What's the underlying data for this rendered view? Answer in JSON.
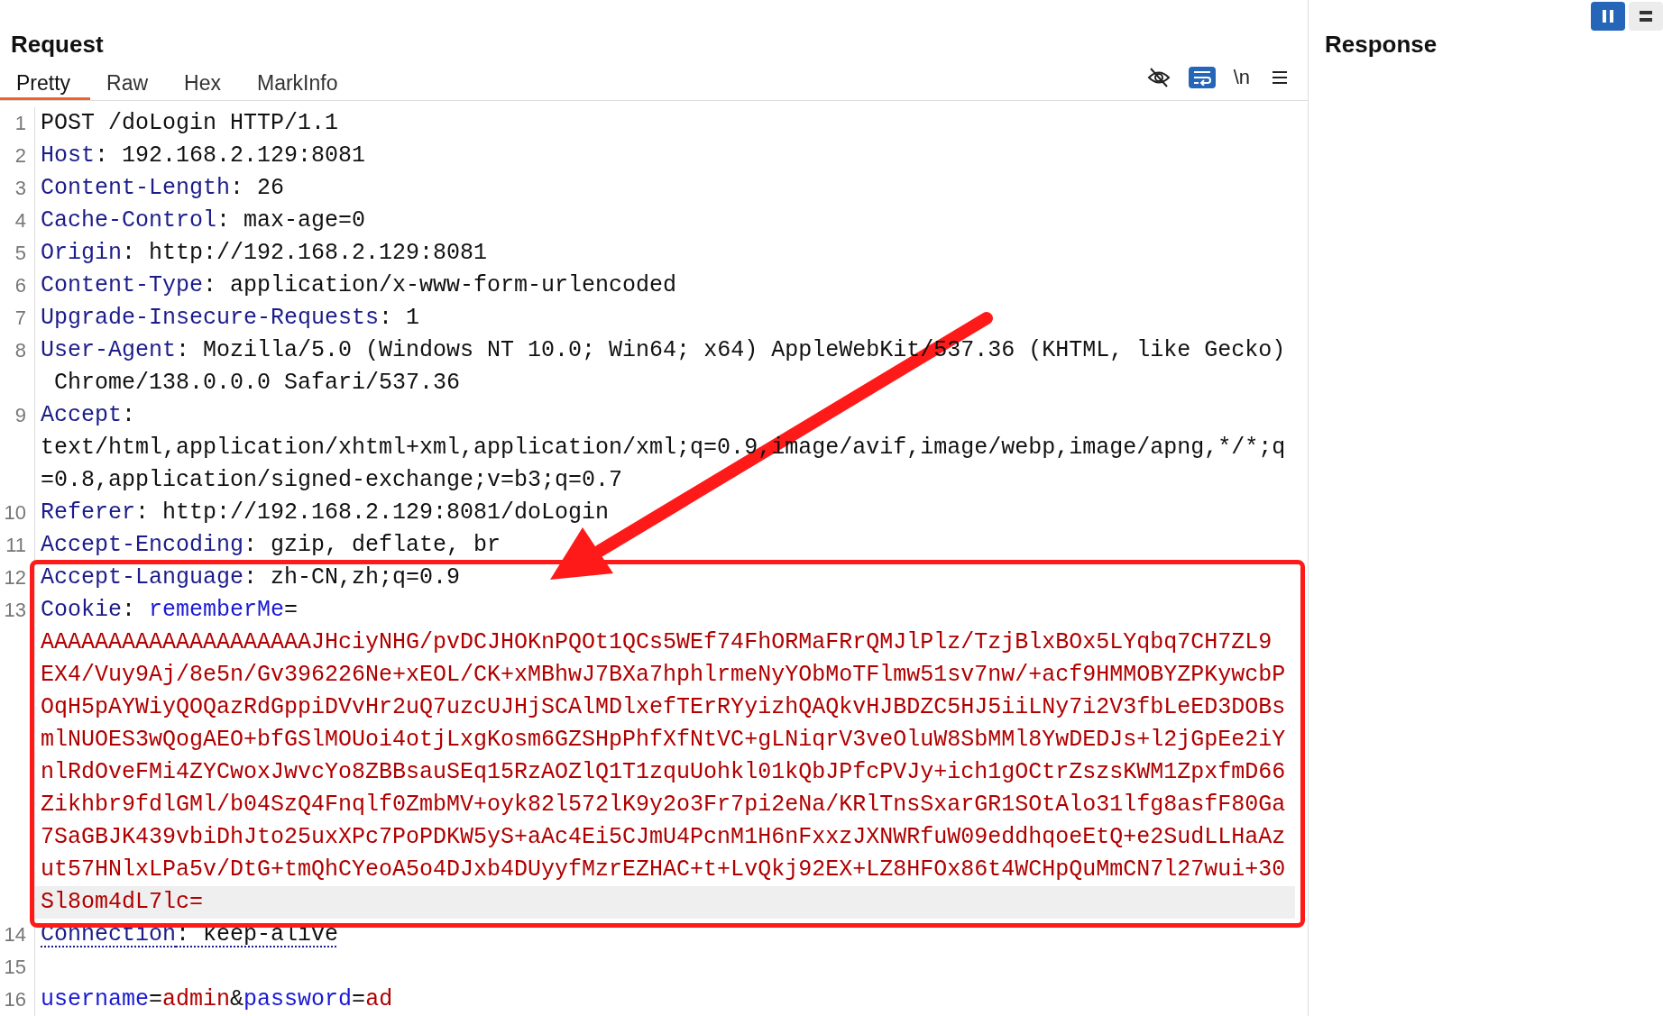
{
  "request": {
    "title": "Request",
    "tabs": [
      {
        "label": "Pretty",
        "selected": true
      },
      {
        "label": "Raw",
        "selected": false
      },
      {
        "label": "Hex",
        "selected": false
      },
      {
        "label": "MarkInfo",
        "selected": false
      }
    ],
    "toolbar": [
      {
        "kind": "hide",
        "selected": false
      },
      {
        "kind": "wrap",
        "selected": true
      },
      {
        "kind": "text",
        "label": "\\n",
        "selected": false
      },
      {
        "kind": "menu",
        "selected": false
      }
    ],
    "lines": [
      {
        "number": "1",
        "selected": false,
        "flagged": false,
        "rows": [
          [
            {
              "kind": "plain",
              "text": "POST /doLogin HTTP/1.1"
            }
          ]
        ]
      },
      {
        "number": "2",
        "selected": false,
        "flagged": false,
        "rows": [
          [
            {
              "kind": "name",
              "text": "Host"
            },
            {
              "kind": "plain",
              "text": ": 192.168.2.129:8081"
            }
          ]
        ]
      },
      {
        "number": "3",
        "selected": false,
        "flagged": false,
        "rows": [
          [
            {
              "kind": "name",
              "text": "Content-Length"
            },
            {
              "kind": "plain",
              "text": ": 26"
            }
          ]
        ]
      },
      {
        "number": "4",
        "selected": false,
        "flagged": false,
        "rows": [
          [
            {
              "kind": "name",
              "text": "Cache-Control"
            },
            {
              "kind": "plain",
              "text": ": max-age=0"
            }
          ]
        ]
      },
      {
        "number": "5",
        "selected": false,
        "flagged": false,
        "rows": [
          [
            {
              "kind": "name",
              "text": "Origin"
            },
            {
              "kind": "plain",
              "text": ": http://192.168.2.129:8081"
            }
          ]
        ]
      },
      {
        "number": "6",
        "selected": false,
        "flagged": false,
        "rows": [
          [
            {
              "kind": "name",
              "text": "Content-Type"
            },
            {
              "kind": "plain",
              "text": ": application/x-www-form-urlencoded"
            }
          ]
        ]
      },
      {
        "number": "7",
        "selected": false,
        "flagged": false,
        "rows": [
          [
            {
              "kind": "name",
              "text": "Upgrade-Insecure-Requests"
            },
            {
              "kind": "plain",
              "text": ": 1"
            }
          ]
        ]
      },
      {
        "number": "8",
        "selected": false,
        "flagged": false,
        "rows": [
          [
            {
              "kind": "name",
              "text": "User-Agent"
            },
            {
              "kind": "plain",
              "text": ": Mozilla/5.0 (Windows NT 10.0; Win64; x64) AppleWebKit/537.36 (KHTML, like Gecko)"
            }
          ],
          [
            {
              "kind": "plain",
              "text": " Chrome/138.0.0.0 Safari/537.36"
            }
          ]
        ]
      },
      {
        "number": "9",
        "selected": false,
        "flagged": false,
        "rows": [
          [
            {
              "kind": "name",
              "text": "Accept"
            },
            {
              "kind": "plain",
              "text": ":"
            }
          ],
          [
            {
              "kind": "plain",
              "text": "text/html,application/xhtml+xml,application/xml;q=0.9,image/avif,image/webp,image/apng,*/*;q"
            }
          ],
          [
            {
              "kind": "plain",
              "text": "=0.8,application/signed-exchange;v=b3;q=0.7"
            }
          ]
        ]
      },
      {
        "number": "10",
        "selected": false,
        "flagged": false,
        "rows": [
          [
            {
              "kind": "name",
              "text": "Referer"
            },
            {
              "kind": "plain",
              "text": ": http://192.168.2.129:8081/doLogin"
            }
          ]
        ]
      },
      {
        "number": "11",
        "selected": false,
        "flagged": false,
        "rows": [
          [
            {
              "kind": "name",
              "text": "Accept-Encoding"
            },
            {
              "kind": "plain",
              "text": ": gzip, deflate, br"
            }
          ]
        ]
      },
      {
        "number": "12",
        "selected": false,
        "flagged": false,
        "rows": [
          [
            {
              "kind": "name",
              "text": "Accept-Language"
            },
            {
              "kind": "plain",
              "text": ": zh-CN,zh;q=0.9"
            }
          ]
        ]
      },
      {
        "number": "13",
        "selected": true,
        "flagged": false,
        "rows": [
          [
            {
              "kind": "name",
              "text": "Cookie"
            },
            {
              "kind": "plain",
              "text": ": "
            },
            {
              "kind": "param",
              "text": "rememberMe"
            },
            {
              "kind": "plain",
              "text": "="
            }
          ],
          [
            {
              "kind": "value",
              "text": "AAAAAAAAAAAAAAAAAAAAJHciyNHG/pvDCJHOKnPQOt1QCs5WEf74FhORMaFRrQMJlPlz/TzjBlxBOx5LYqbq7CH7ZL9"
            }
          ],
          [
            {
              "kind": "value",
              "text": "EX4/Vuy9Aj/8e5n/Gv396226Ne+xEOL/CK+xMBhwJ7BXa7hphlrmeNyYObMoTFlmw51sv7nw/+acf9HMMOBYZPKywcbP"
            }
          ],
          [
            {
              "kind": "value",
              "text": "OqH5pAYWiyQOQazRdGppiDVvHr2uQ7uzcUJHjSCAlMDlxefTErRYyizhQAQkvHJBDZC5HJ5iiLNy7i2V3fbLeED3DOBs"
            }
          ],
          [
            {
              "kind": "value",
              "text": "mlNUOES3wQogAEO+bfGSlMOUoi4otjLxgKosm6GZSHpPhfXfNtVC+gLNiqrV3veOluW8SbMMl8YwDEDJs+l2jGpEe2iY"
            }
          ],
          [
            {
              "kind": "value",
              "text": "nlRdOveFMi4ZYCwoxJwvcYo8ZBBsauSEq15RzAOZlQ1T1zquUohkl01kQbJPfcPVJy+ich1gOCtrZszsKWM1ZpxfmD66"
            }
          ],
          [
            {
              "kind": "value",
              "text": "Zikhbr9fdlGMl/b04SzQ4Fnqlf0ZmbMV+oyk82l572lK9y2o3Fr7pi2eNa/KRlTnsSxarGR1SOtAlo31lfg8asfF80Ga"
            }
          ],
          [
            {
              "kind": "value",
              "text": "7SaGBJK439vbiDhJto25uxXPc7PoPDKW5yS+aAc4Ei5CJmU4PcnM1H6nFxxzJXNWRfuW09eddhqoeEtQ+e2SudLLHaAz"
            }
          ],
          [
            {
              "kind": "value",
              "text": "ut57HNlxLPa5v/DtG+tmQhCYeoA5o4DJxb4DUyyfMzrEZHAC+t+LvQkj92EX+LZ8HFOx86t4WCHpQuMmCN7l27wui+30"
            }
          ],
          [
            {
              "kind": "value",
              "text": "Sl8om4dL7lc="
            }
          ]
        ]
      },
      {
        "number": "14",
        "selected": false,
        "flagged": true,
        "rows": [
          [
            {
              "kind": "name",
              "text": "Connection"
            },
            {
              "kind": "plain",
              "text": ": keep-alive"
            }
          ]
        ]
      },
      {
        "number": "15",
        "selected": false,
        "flagged": false
      },
      {
        "number": "16",
        "selected": false,
        "flagged": false,
        "rows": [
          [
            {
              "kind": "param",
              "text": "username"
            },
            {
              "kind": "plain",
              "text": "="
            },
            {
              "kind": "value",
              "text": "admin"
            },
            {
              "kind": "plain",
              "text": "&"
            },
            {
              "kind": "param",
              "text": "password"
            },
            {
              "kind": "plain",
              "text": "="
            },
            {
              "kind": "value",
              "text": "ad"
            }
          ]
        ]
      }
    ]
  },
  "response": {
    "title": "Response"
  },
  "layout_toggles": [
    {
      "kind": "columns",
      "selected": true
    },
    {
      "kind": "rows",
      "selected": false
    }
  ]
}
